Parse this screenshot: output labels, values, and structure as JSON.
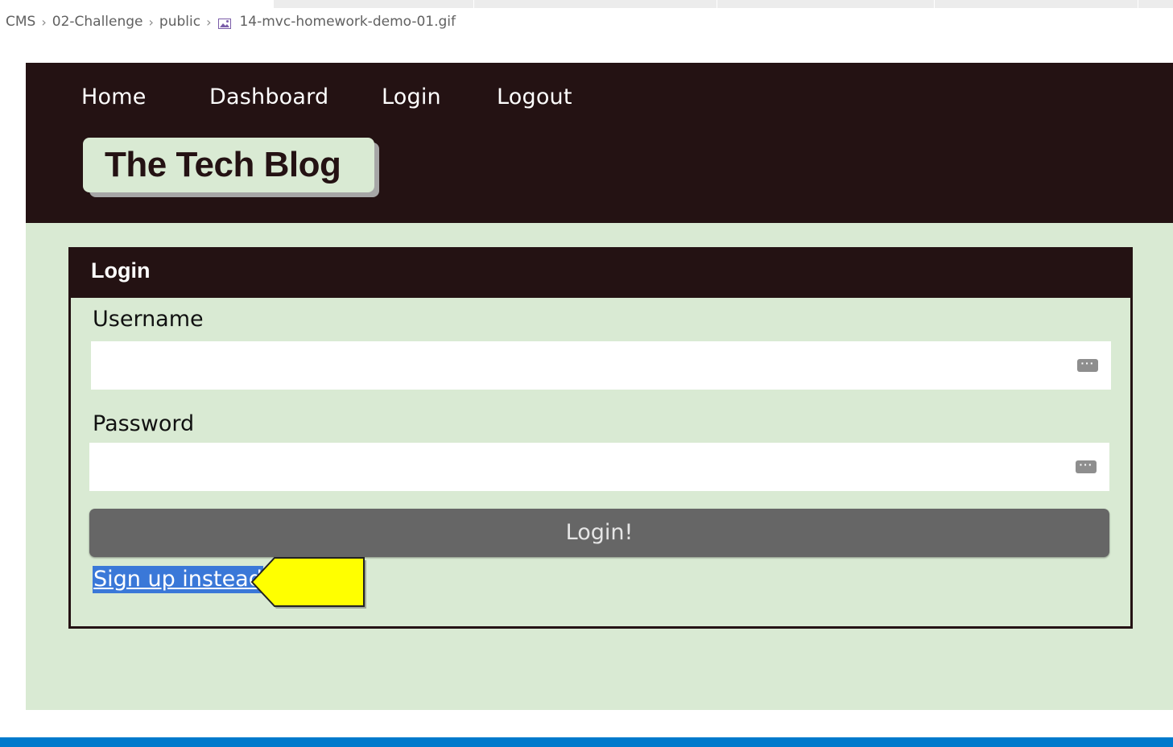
{
  "breadcrumb": {
    "items": [
      "CMS",
      "02-Challenge",
      "public"
    ],
    "file": "14-mvc-homework-demo-01.gif",
    "separator": ">"
  },
  "nav": {
    "home": "Home",
    "dashboard": "Dashboard",
    "login": "Login",
    "logout": "Logout"
  },
  "brand": {
    "title": "The Tech Blog"
  },
  "login_card": {
    "title": "Login",
    "username_label": "Username",
    "username_value": "",
    "password_label": "Password",
    "password_value": "",
    "submit_label": "Login!",
    "signup_link": "Sign up instead",
    "field_menu_glyph": "···"
  },
  "colors": {
    "header_bg": "#241213",
    "page_bg": "#d9ead3",
    "button_bg": "#666666",
    "selection": "#3a78d8",
    "annotation_arrow": "#ffff00",
    "statusbar": "#007acc"
  },
  "icons": {
    "breadcrumb_file": "image-file-icon",
    "field_menu": "more-dots-icon",
    "annotation": "arrow-left-callout"
  }
}
